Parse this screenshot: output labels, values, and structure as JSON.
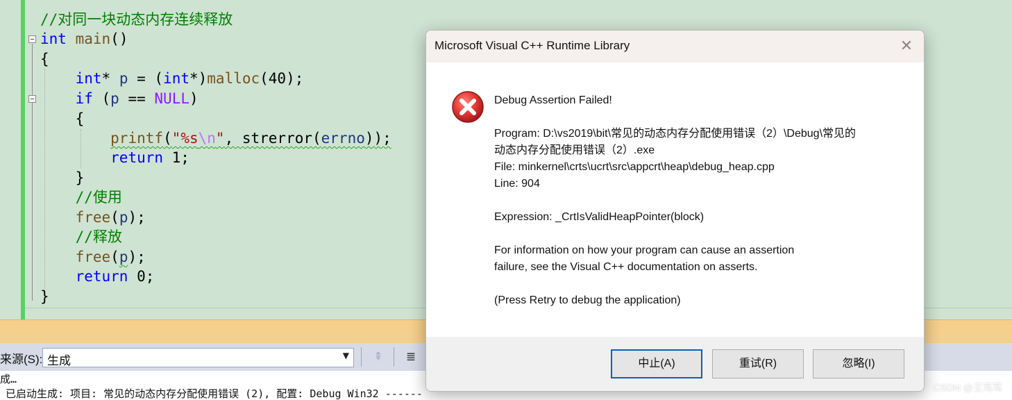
{
  "editor": {
    "lines": [
      {
        "comment": "//对同一块动态内存连续释放"
      },
      {
        "kw": "int",
        "fn": "main",
        "rest": "()"
      },
      {
        "text": "{"
      },
      {
        "kw1": "int",
        "p1": "* ",
        "var": "p",
        "p2": " = (",
        "kw2": "int",
        "p3": "*)",
        "fn": "malloc",
        "p4": "(40);"
      },
      {
        "kw": "if",
        "p1": " (",
        "var": "p",
        "p2": " == ",
        "macro": "NULL",
        "p3": ")"
      },
      {
        "text": "{"
      },
      {
        "fn": "printf",
        "p1": "(",
        "str1": "\"%s",
        "esc": "\\n",
        "str2": "\"",
        "p2": ", strerror(",
        "var": "errno",
        "p3": "));"
      },
      {
        "kw": "return",
        "rest": " 1;"
      },
      {
        "text": "}"
      },
      {
        "comment": "//使用"
      },
      {
        "fn": "free",
        "p1": "(",
        "var": "p",
        "p2": ");"
      },
      {
        "comment": "//释放"
      },
      {
        "fn": "free",
        "p1": "(",
        "var": "p",
        "p2": ");"
      },
      {
        "kw": "return",
        "rest": " 0;"
      },
      {
        "text": "}"
      }
    ]
  },
  "output_panel": {
    "source_label": "来源(S):",
    "source_value": "生成",
    "lines": [
      "成…",
      "已启动生成: 项目: 常见的动态内存分配使用错误 (2), 配置: Debug Win32 ------"
    ]
  },
  "dialog": {
    "title": "Microsoft Visual C++ Runtime Library",
    "heading": "Debug Assertion Failed!",
    "program_line1": "Program: D:\\vs2019\\bit\\常见的动态内存分配使用错误（2）\\Debug\\常见的",
    "program_line2": "动态内存分配使用错误（2）.exe",
    "file_line": "File: minkernel\\crts\\ucrt\\src\\appcrt\\heap\\debug_heap.cpp",
    "line_line": "Line: 904",
    "expression_line": "Expression: _CrtIsValidHeapPointer(block)",
    "info_line1": "For information on how your program can cause an assertion",
    "info_line2": "failure, see the Visual C++ documentation on asserts.",
    "retry_hint": "(Press Retry to debug the application)",
    "buttons": {
      "abort": "中止(A)",
      "retry": "重试(R)",
      "ignore": "忽略(I)"
    }
  },
  "watermark": "CSDN @王笃笃",
  "colors": {
    "editor_bg": "#cfe3d2",
    "change_bar": "#58d163",
    "keyword": "#0000ff",
    "function": "#74531f",
    "comment": "#008000",
    "string": "#a31515",
    "panel_header": "#f5cf8c",
    "error_red": "#d32f2f"
  }
}
